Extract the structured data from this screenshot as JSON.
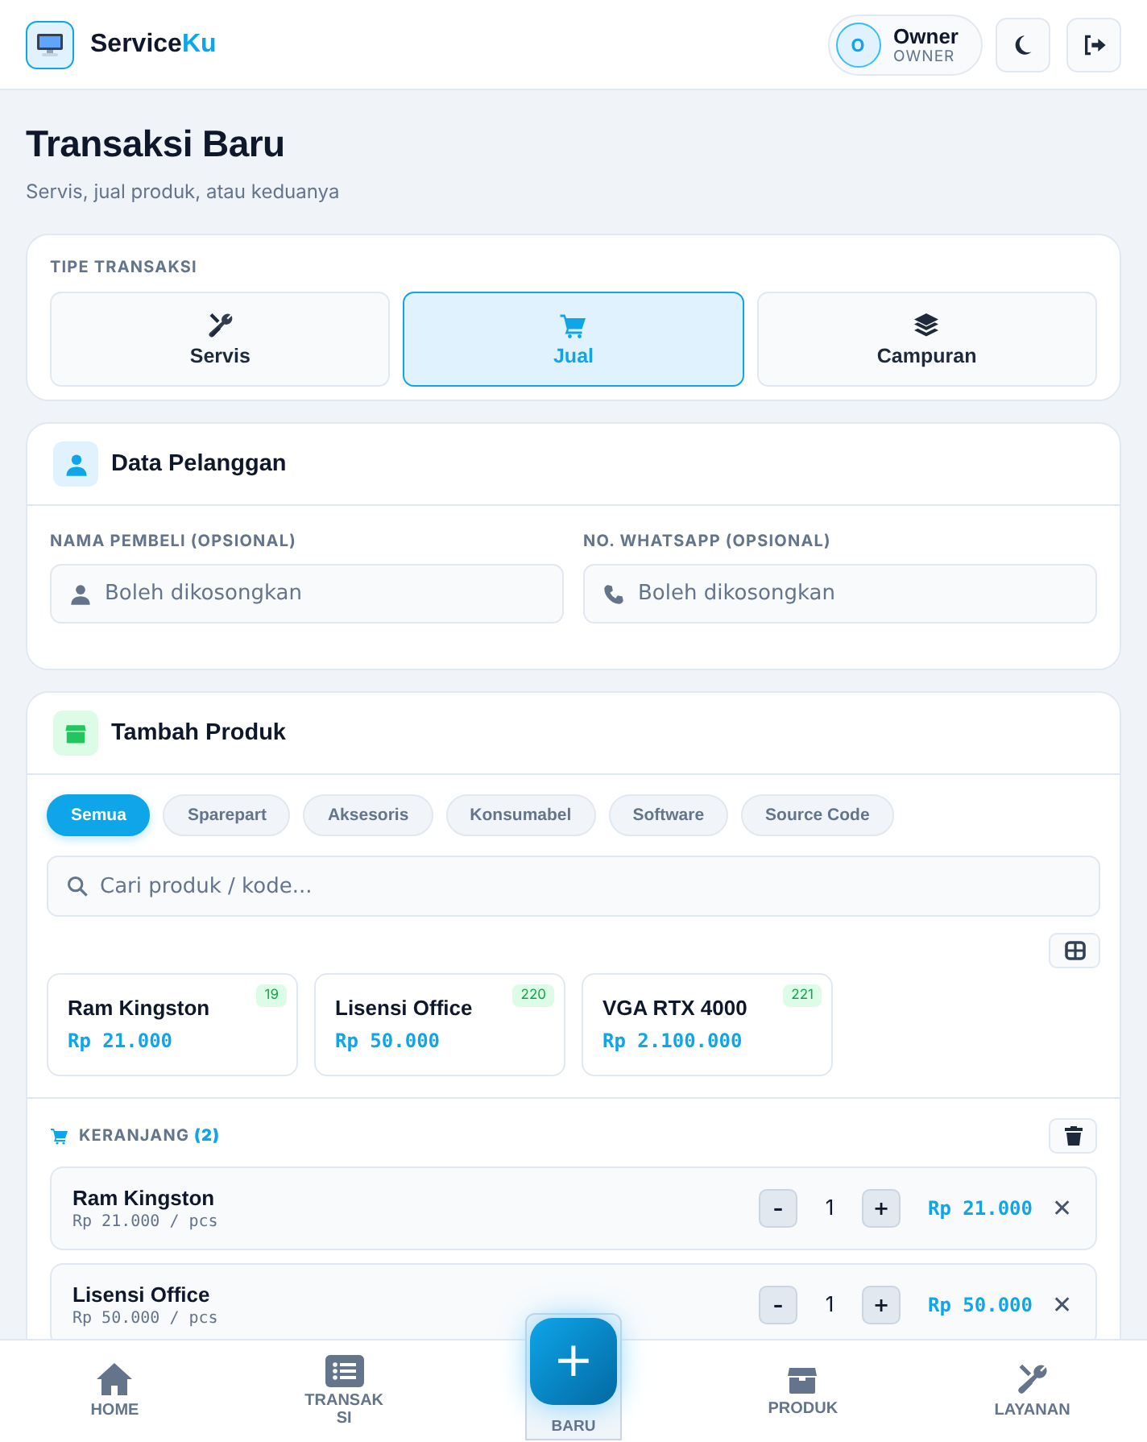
{
  "header": {
    "brand": "Service",
    "brand_accent": "Ku",
    "user": {
      "initial": "O",
      "name": "Owner",
      "role": "OWNER"
    }
  },
  "page": {
    "title": "Transaksi Baru",
    "subtitle": "Servis, jual produk, atau keduanya"
  },
  "transaction_type": {
    "label": "TIPE TRANSAKSI",
    "options": [
      {
        "label": "Servis",
        "selected": false
      },
      {
        "label": "Jual",
        "selected": true
      },
      {
        "label": "Campuran",
        "selected": false
      }
    ]
  },
  "customer": {
    "title": "Data Pelanggan",
    "fields": [
      {
        "kind": "name",
        "label": "NAMA PEMBELI (OPSIONAL)",
        "placeholder": "Boleh dikosongkan"
      },
      {
        "kind": "phone",
        "label": "NO. WHATSAPP (OPSIONAL)",
        "placeholder": "Boleh dikosongkan"
      }
    ]
  },
  "products": {
    "title": "Tambah Produk",
    "filters": [
      {
        "label": "Semua",
        "selected": true
      },
      {
        "label": "Sparepart",
        "selected": false
      },
      {
        "label": "Aksesoris",
        "selected": false
      },
      {
        "label": "Konsumabel",
        "selected": false
      },
      {
        "label": "Software",
        "selected": false
      },
      {
        "label": "Source Code",
        "selected": false
      }
    ],
    "search": {
      "placeholder": "Cari produk / kode..."
    },
    "items": [
      {
        "name": "Ram Kingston",
        "price": "Rp 21.000",
        "stock": "19"
      },
      {
        "name": "Lisensi Office",
        "price": "Rp 50.000",
        "stock": "220"
      },
      {
        "name": "VGA RTX 4000",
        "price": "Rp 2.100.000",
        "stock": "221"
      }
    ]
  },
  "cart": {
    "label": "KERANJANG",
    "count": "(2)",
    "items": [
      {
        "name": "Ram Kingston",
        "unit_price": "Rp 21.000 / pcs",
        "qty": "1",
        "minus": "–",
        "plus": "+",
        "total": "Rp 21.000",
        "remove": "✕"
      },
      {
        "name": "Lisensi Office",
        "unit_price": "Rp 50.000 / pcs",
        "qty": "1",
        "minus": "–",
        "plus": "+",
        "total": "Rp 50.000",
        "remove": "✕"
      }
    ]
  },
  "bottom_nav": {
    "items": [
      {
        "label": "HOME"
      },
      {
        "label": "TRANSAKSI"
      },
      {
        "label": "PRODUK"
      },
      {
        "label": "LAYANAN"
      }
    ],
    "fab": {
      "icon": "+",
      "label": "BARU"
    }
  }
}
